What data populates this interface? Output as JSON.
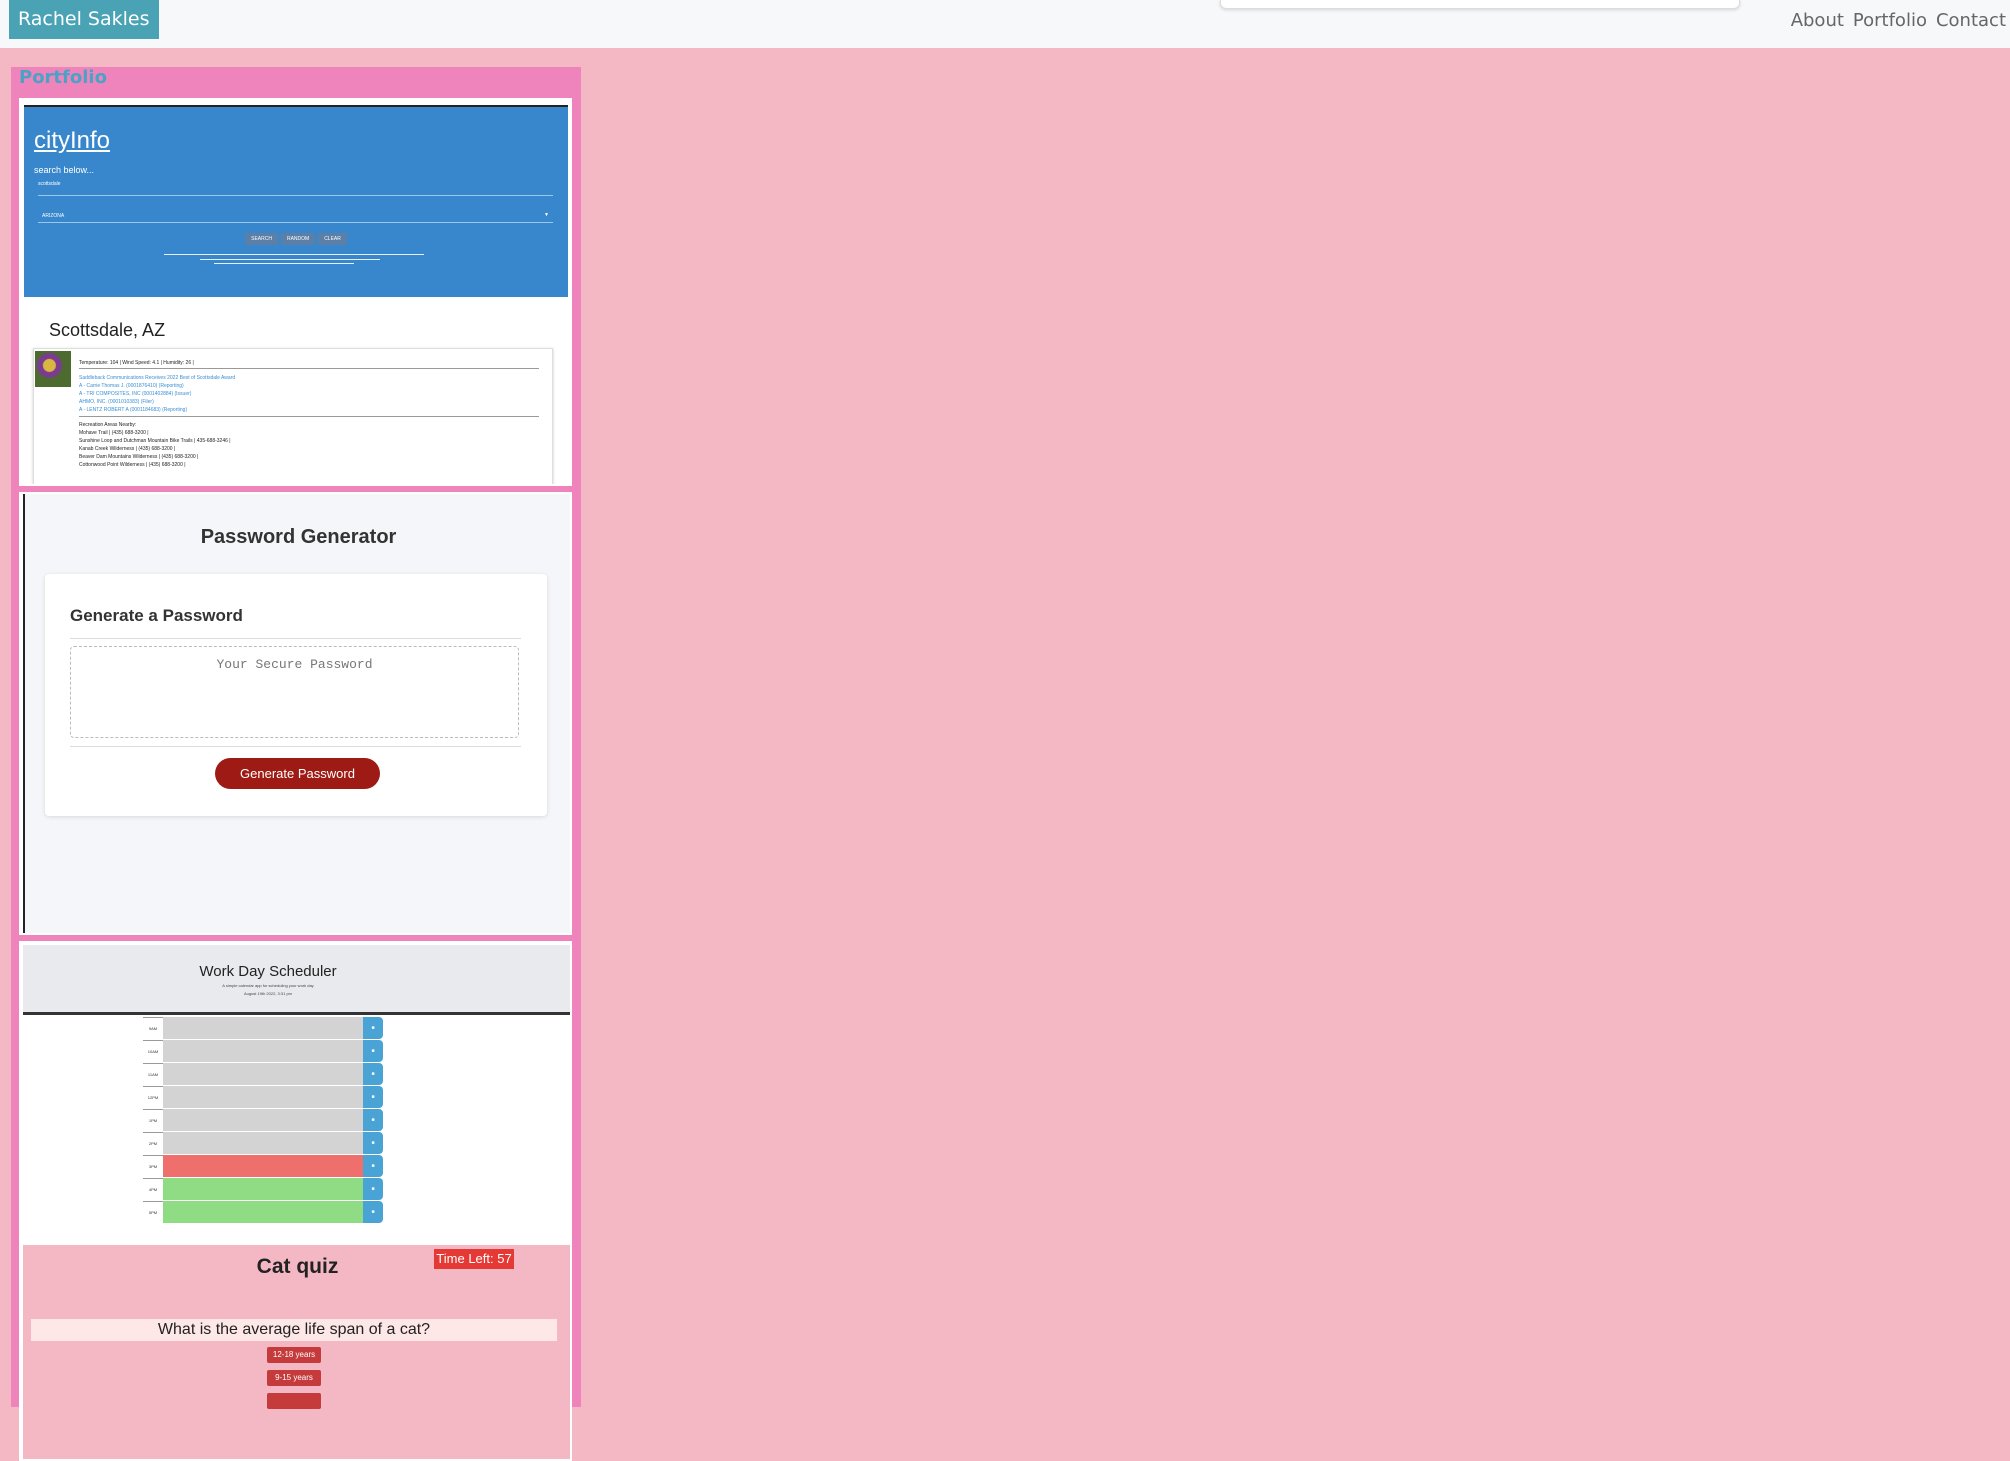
{
  "header": {
    "brand": "Rachel Sakles",
    "nav": [
      "About",
      "Portfolio",
      "Contact"
    ]
  },
  "portfolio": {
    "title": "Portfolio",
    "cityinfo": {
      "title": "cityInfo",
      "subtitle": "search below...",
      "input_value": "scottsdale",
      "state_select": "ARIZONA",
      "buttons": [
        "SEARCH",
        "RANDOM",
        "CLEAR"
      ],
      "city": "Scottsdale, AZ",
      "weather": "Temperature: 104 | Wind Speed: 4.1 | Humidity: 26 |",
      "links": [
        "Saddleback Communications Receives 2022 Best of Scottsdale Award",
        "A - Carrie Thomas J. (0001876410) (Reporting)",
        "A - TRI COMPOSITES, INC (0001402884) (Issuer)",
        "AHMO, INC. (0001010383) (Filer)",
        "A - LENTZ ROBERT A (0001184683) (Reporting)"
      ],
      "recreation_heading": "Recreation Areas Nearby:",
      "recreation": [
        "Mohave Trail | (435) 688-3200 |",
        "Sunshine Loop and Dutchman Mountain Bike Trails | 435-688-3246 |",
        "Kanab Creek Wilderness | (435) 688-3200 |",
        "Beaver Dam Mountains Wilderness | (435) 688-3200 |",
        "Cottonwood Point Wilderness | (435) 688-3200 |"
      ]
    },
    "password_generator": {
      "title": "Password Generator",
      "card_title": "Generate a Password",
      "placeholder": "Your Secure Password",
      "button": "Generate Password"
    },
    "scheduler": {
      "title": "Work Day Scheduler",
      "subtitle": "A simple calendar app for scheduling your work day",
      "date": "August 19th 2022, 3:31 pm",
      "hours": [
        "9AM",
        "10AM",
        "11AM",
        "12PM",
        "1PM",
        "2PM",
        "3PM",
        "4PM",
        "5PM"
      ],
      "states": [
        "past",
        "past",
        "past",
        "past",
        "past",
        "past",
        "present",
        "future",
        "future"
      ],
      "colors": {
        "past": "#d3d3d3",
        "present": "#ef6f6c",
        "future": "#8fdc84",
        "save": "#4aa3d5"
      }
    },
    "cat_quiz": {
      "title": "Cat quiz",
      "timer": "Time Left: 57",
      "question": "What is the average life span of a cat?",
      "options": [
        "12-18 years",
        "9-15 years",
        ""
      ]
    }
  }
}
